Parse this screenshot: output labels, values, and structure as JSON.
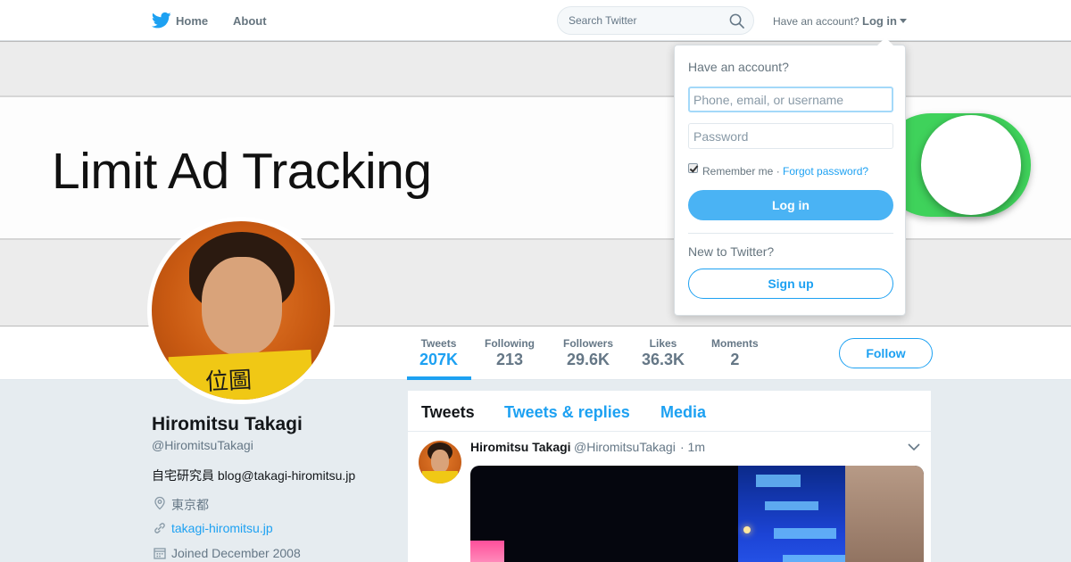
{
  "header": {
    "nav_home": "Home",
    "nav_about": "About",
    "search_placeholder": "Search Twitter",
    "have_account": "Have an account?",
    "login": "Log in"
  },
  "banner": {
    "text": "Limit Ad Tracking"
  },
  "avatar": {
    "sign_text": "位圖"
  },
  "profile": {
    "name": "Hiromitsu Takagi",
    "handle": "@HiromitsuTakagi",
    "bio": "自宅研究員 blog@takagi-hiromitsu.jp",
    "location": "東京都",
    "website": "takagi-hiromitsu.jp",
    "joined": "Joined December 2008"
  },
  "stats": [
    {
      "label": "Tweets",
      "value": "207K"
    },
    {
      "label": "Following",
      "value": "213"
    },
    {
      "label": "Followers",
      "value": "29.6K"
    },
    {
      "label": "Likes",
      "value": "36.3K"
    },
    {
      "label": "Moments",
      "value": "2"
    }
  ],
  "follow_label": "Follow",
  "timeline": {
    "tabs": [
      "Tweets",
      "Tweets & replies",
      "Media"
    ],
    "tweet": {
      "name": "Hiromitsu Takagi",
      "handle": "@HiromitsuTakagi",
      "time": "· 1m"
    }
  },
  "login_dropdown": {
    "heading": "Have an account?",
    "username_placeholder": "Phone, email, or username",
    "password_placeholder": "Password",
    "remember": "Remember me ·",
    "forgot": "Forgot password?",
    "login_button": "Log in",
    "new_to_twitter": "New to Twitter?",
    "signup_button": "Sign up"
  },
  "colors": {
    "brand": "#1da1f2",
    "toggle_green": "#3fd25b"
  }
}
